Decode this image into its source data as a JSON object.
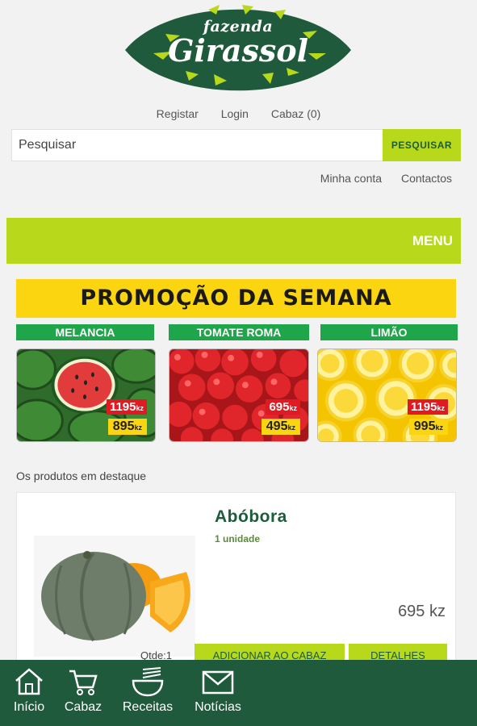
{
  "brand": {
    "line1": "fazenda",
    "line2": "Girassol"
  },
  "top_links": {
    "register": "Registar",
    "login": "Login",
    "cart": "Cabaz  (0)"
  },
  "search": {
    "placeholder": "Pesquisar",
    "button": "PESQUISAR"
  },
  "account_links": {
    "my_account": "Minha conta",
    "contacts": "Contactos"
  },
  "menu": {
    "label": "MENU"
  },
  "promo": {
    "title": "PROMOÇÃO DA SEMANA",
    "items": [
      {
        "name": "MELANCIA",
        "old_price": "1195",
        "new_price": "895",
        "unit": "kz"
      },
      {
        "name": "TOMATE ROMA",
        "old_price": "695",
        "new_price": "495",
        "unit": "kz"
      },
      {
        "name": "LIMÃO",
        "old_price": "1195",
        "new_price": "995",
        "unit": "kz"
      }
    ]
  },
  "featured": {
    "title": "Os produtos em destaque",
    "product": {
      "name": "Abóbora",
      "unit": "1 unidade",
      "price": "695 kz",
      "qty_label": "Qtde:1",
      "add_button": "ADICIONAR AO CABAZ",
      "details_button": "DETALHES"
    }
  },
  "bottom_nav": [
    {
      "label": "Início",
      "icon": "home-icon"
    },
    {
      "label": "Cabaz",
      "icon": "cart-icon"
    },
    {
      "label": "Receitas",
      "icon": "bowl-icon"
    },
    {
      "label": "Notícias",
      "icon": "envelope-icon"
    }
  ],
  "colors": {
    "accent": "#b8d81c",
    "brand_green": "#1f5a3c",
    "promo_yellow": "#fbd610",
    "promo_red": "#e01a22",
    "label_green": "#1fa64a"
  }
}
